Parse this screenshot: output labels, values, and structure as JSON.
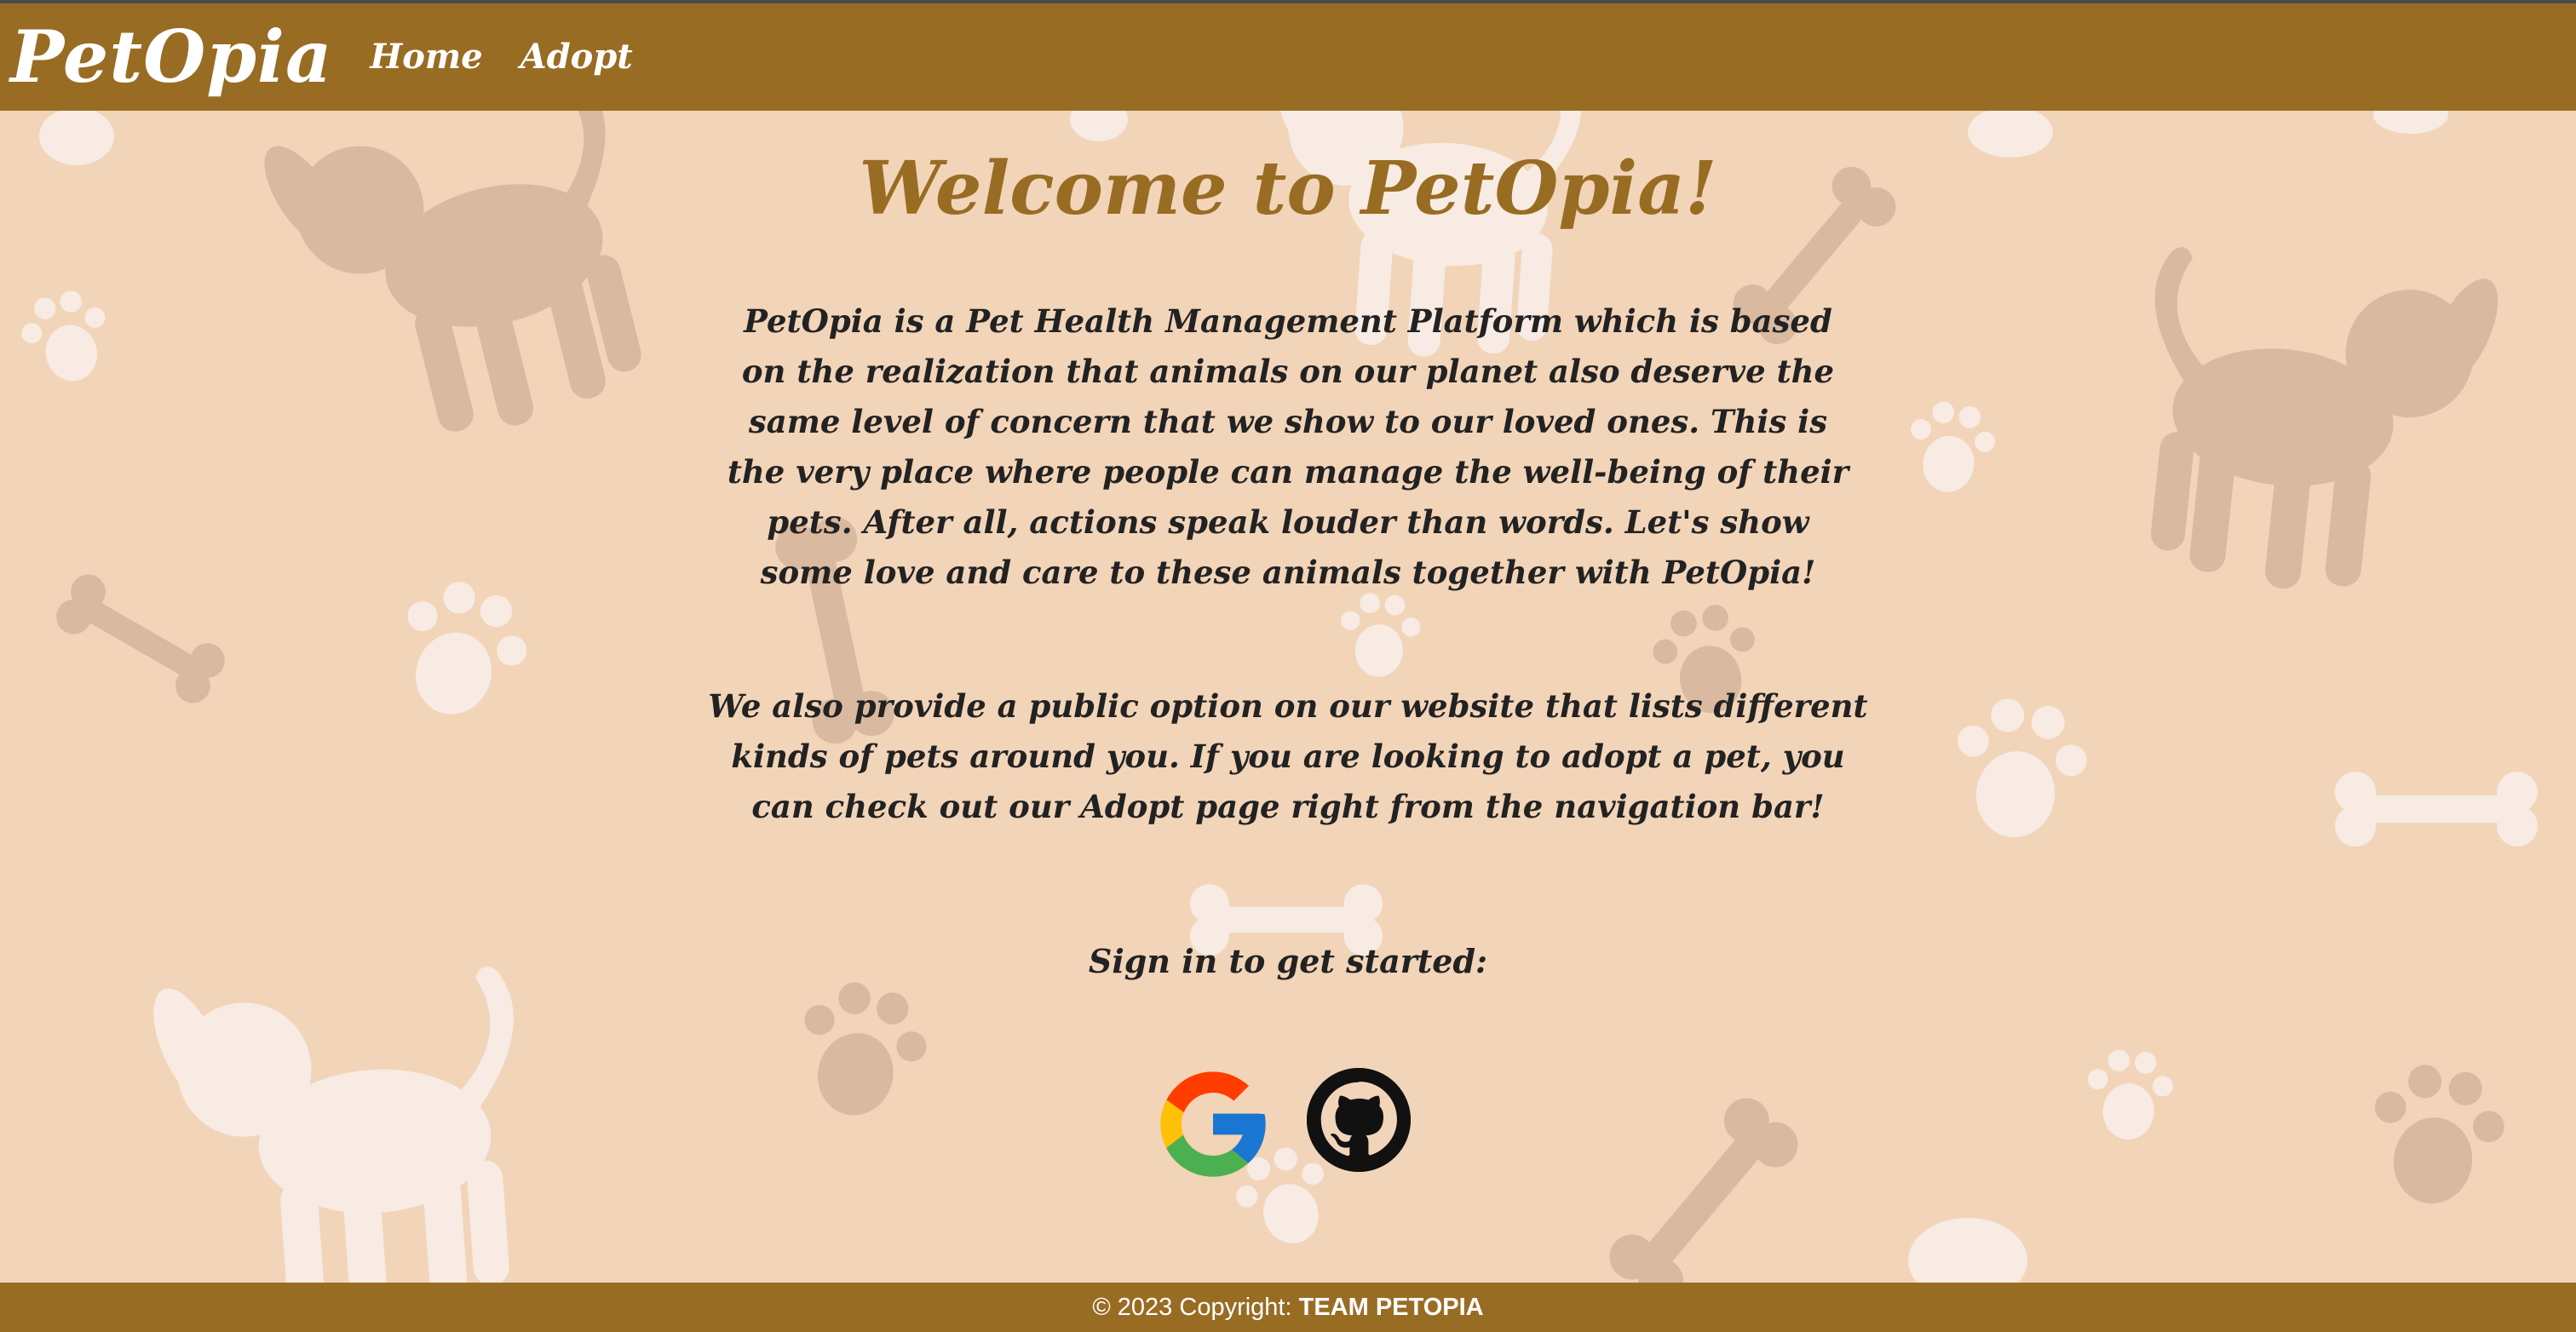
{
  "navbar": {
    "brand": "PetOpia",
    "links": [
      "Home",
      "Adopt"
    ]
  },
  "main": {
    "title": "Welcome to PetOpia!",
    "paragraph1": "PetOpia is a Pet Health Management Platform which is based on the realization that animals on our planet also deserve the same level of concern that we show to our loved ones. This is the very place where people can manage the well-being of their pets. After all, actions speak louder than words. Let's show some love and care to these animals together with PetOpia!",
    "paragraph2": "We also provide a public option on our website that lists different kinds of pets around you. If you are looking to adopt a pet, you can check out our Adopt page right from the navigation bar!",
    "signin_prompt": "Sign in to get started:",
    "signin_options": [
      {
        "icon": "google-icon"
      },
      {
        "icon": "github-icon"
      }
    ]
  },
  "footer": {
    "copyright": "© 2023 Copyright: ",
    "team": "TEAM PETOPIA"
  },
  "colors": {
    "navbar": "#996c24",
    "background": "#f2d4b9",
    "title": "#996c24",
    "text": "#222222",
    "decor_dark": "#d9b9a0",
    "decor_light": "#f7ebe3"
  }
}
